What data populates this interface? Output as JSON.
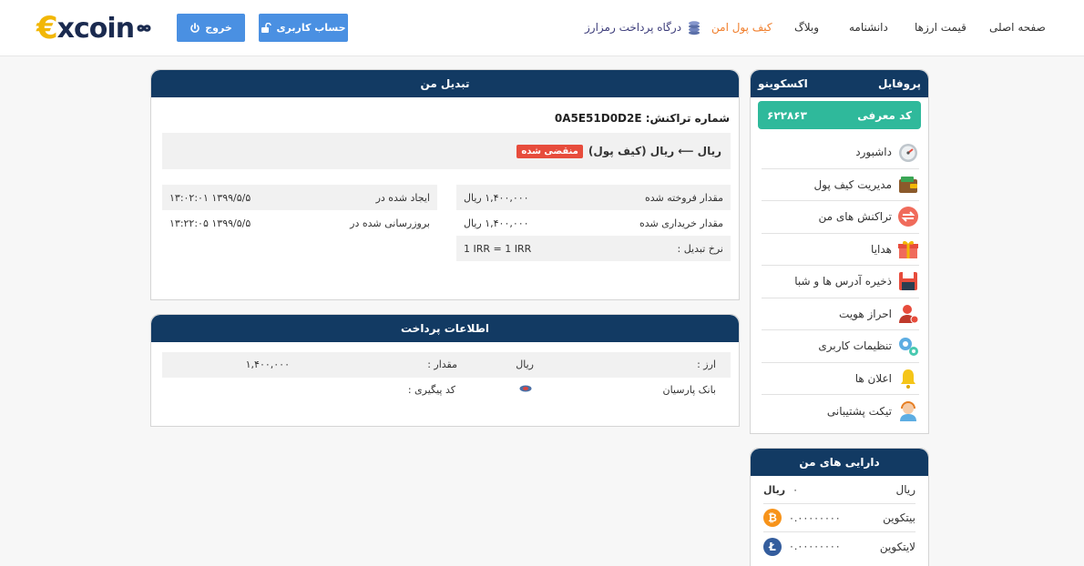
{
  "header": {
    "logo": "excoin",
    "logout_label": "خروج",
    "account_label": "حساب کاربری",
    "nav": [
      {
        "label": "صفحه اصلی"
      },
      {
        "label": "قیمت ارزها"
      },
      {
        "label": "دانشنامه"
      },
      {
        "label": "وبلاگ"
      },
      {
        "label": "کیف پول امن"
      },
      {
        "label": "درگاه پرداخت رمزارز"
      }
    ]
  },
  "profile": {
    "title": "پروفایل",
    "name": "اکسکوینو",
    "ref_label": "کد معرفی",
    "ref_code": "۶۲۲۸۶۳",
    "menu": [
      {
        "label": "داشبورد",
        "icon": "speedometer-icon"
      },
      {
        "label": "مدیریت کیف پول",
        "icon": "wallet-icon"
      },
      {
        "label": "تراکنش های من",
        "icon": "exchange-icon"
      },
      {
        "label": "هدایا",
        "icon": "gift-icon"
      },
      {
        "label": "ذخیره آدرس ها و شبا",
        "icon": "floppy-icon"
      },
      {
        "label": "احراز هویت",
        "icon": "user-verify-icon"
      },
      {
        "label": "تنظیمات کاربری",
        "icon": "gears-icon"
      },
      {
        "label": "اعلان ها",
        "icon": "bell-icon"
      },
      {
        "label": "تیکت پشتیبانی",
        "icon": "support-icon"
      }
    ]
  },
  "assets": {
    "title": "دارایی های من",
    "items": [
      {
        "name": "ریال",
        "value": "۰",
        "symbol": "ریال"
      },
      {
        "name": "بیتکوین",
        "value": "۰.۰۰۰۰۰۰۰۰",
        "symbol": "₿",
        "color": "#f7931a"
      },
      {
        "name": "لایتکوین",
        "value": "۰.۰۰۰۰۰۰۰۰",
        "symbol": "Ł",
        "color": "#345d9d"
      }
    ]
  },
  "exchange": {
    "title": "تبدیل من",
    "tx_label": "شماره تراکنش:",
    "tx_id": "0A5E51D0D2E",
    "pair_text": "ریال ⟵ ریال (کیف پول)",
    "status": "منقضی شده",
    "right_rows": [
      {
        "label": "مقدار فروخته شده",
        "value": "۱,۴۰۰,۰۰۰ ریال"
      },
      {
        "label": "مقدار خریداری شده",
        "value": "۱,۴۰۰,۰۰۰ ریال"
      },
      {
        "label": "نرخ تبدیل :",
        "value": "1 IRR = 1 IRR"
      }
    ],
    "left_rows": [
      {
        "label": "ایجاد شده در",
        "value": "۱۳۹۹/۵/۵ ۱۳:۰۲:۰۱"
      },
      {
        "label": "بروزرسانی شده در",
        "value": "۱۳۹۹/۵/۵ ۱۳:۲۲:۰۵"
      }
    ]
  },
  "payment": {
    "title": "اطلاعات پرداخت",
    "currency_label": "ارز :",
    "currency_value": "ریال",
    "amount_label": "مقدار :",
    "amount_value": "۱,۴۰۰,۰۰۰",
    "bank_name": "بانک پارسیان",
    "tracking_label": "کد پیگیری :"
  },
  "colors": {
    "primary": "#123a63",
    "accent": "#4a90e2",
    "referral": "#2fb99b",
    "active_nav": "#f07d2a",
    "expired": "#e74c3c"
  }
}
